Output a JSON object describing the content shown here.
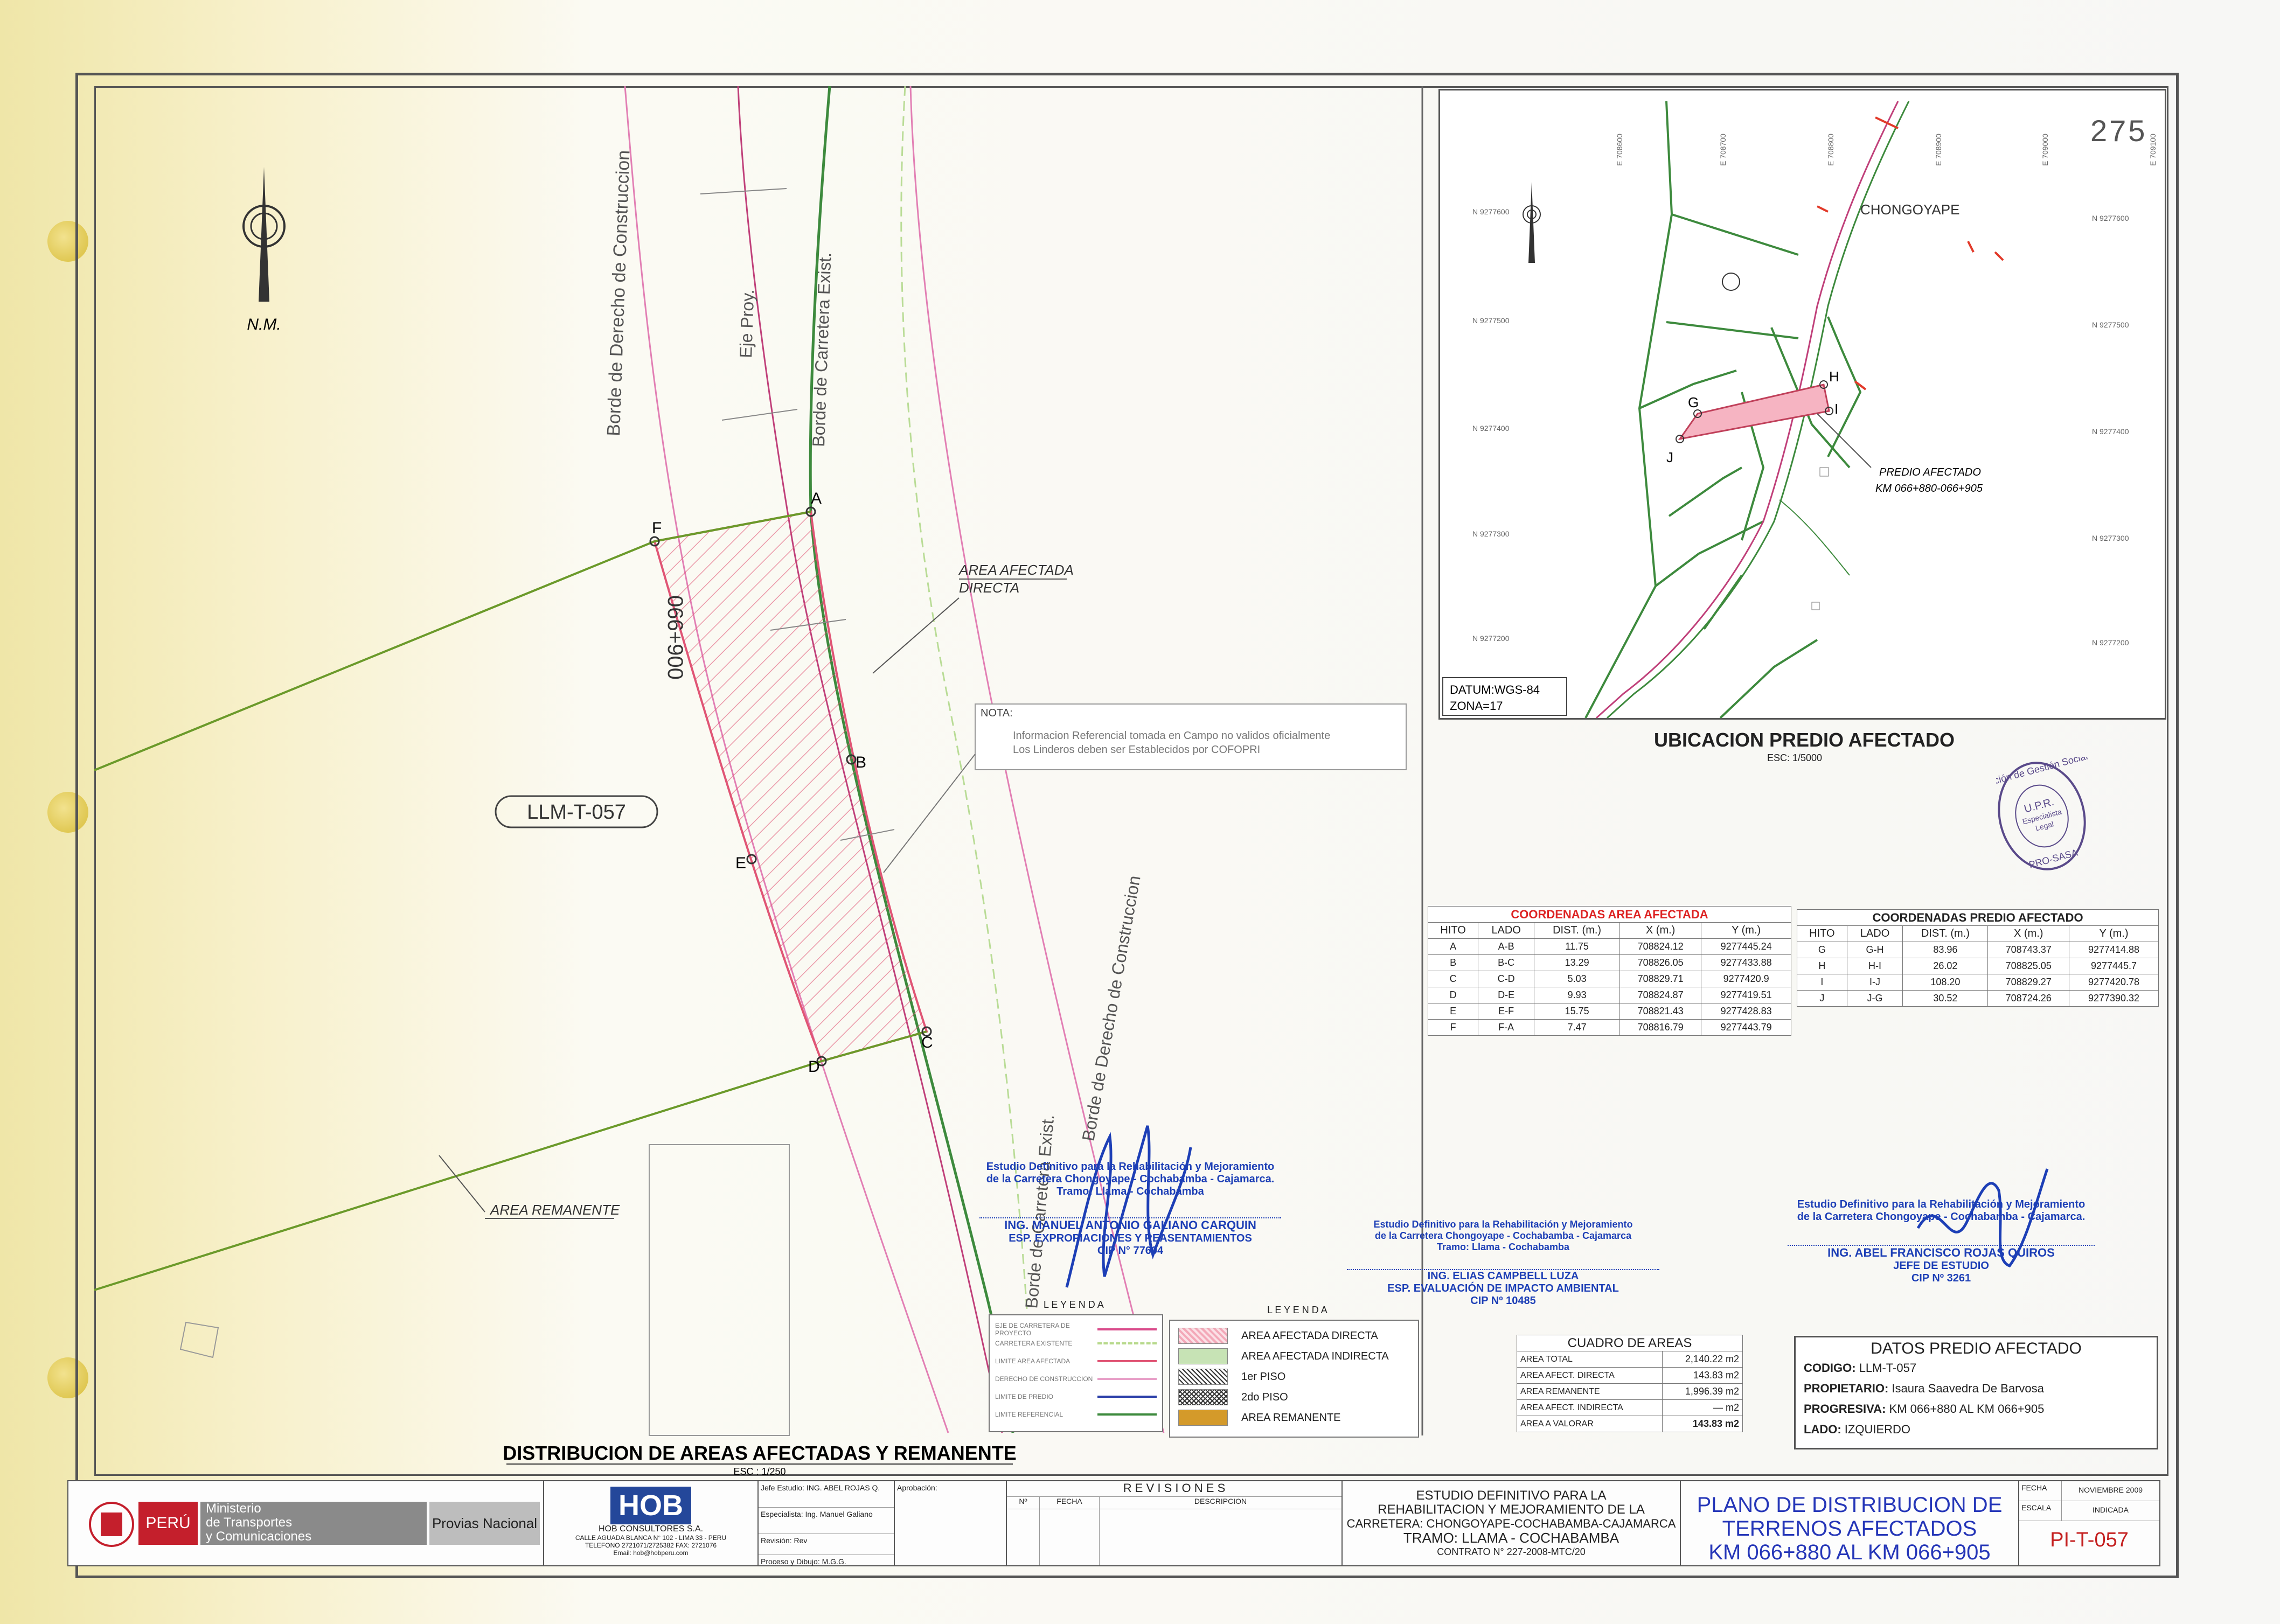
{
  "sheet_number": "275",
  "main_plan": {
    "labels": {
      "borde_derecho_left": "Borde de Derecho de Construccion",
      "eje_proy": "Eje Proy.",
      "borde_carretera_top": "Borde de Carretera Exist.",
      "borde_carretera_bottom": "Borde de Carretera Exist.",
      "borde_derecho_right": "Borde de Derecho de Construccion",
      "progresiva": "066+900",
      "lot_code": "LLM-T-057",
      "area_afectada_1": "AREA AFECTADA",
      "area_afectada_2": "DIRECTA",
      "area_remanente": "AREA REMANENTE",
      "north": "N.M."
    },
    "points": [
      "A",
      "B",
      "C",
      "D",
      "E",
      "F"
    ],
    "note_title": "NOTA:",
    "note_line1": "Informacion Referencial tomada en Campo no validos oficialmente",
    "note_line2": "Los Linderos deben ser Establecidos por COFOPRI",
    "title": "DISTRIBUCION DE AREAS AFECTADAS Y REMANENTE",
    "scale": "ESC : 1/250"
  },
  "location_map": {
    "town": "CHONGOYAPE",
    "points": [
      "G",
      "H",
      "I",
      "J"
    ],
    "predio_1": "PREDIO AFECTADO",
    "predio_2": "KM 066+880-066+905",
    "datum": "DATUM:WGS-84",
    "zona": "ZONA=17",
    "title": "UBICACION PREDIO AFECTADO",
    "scale": "ESC: 1/5000",
    "north_ticks": [
      "N 9277600",
      "N 9277500",
      "N 9277400",
      "N 9277300",
      "N 9277200"
    ],
    "east_ticks": [
      "E 708600",
      "E 708700",
      "E 708800",
      "E 708900",
      "E 709000",
      "E 709100"
    ]
  },
  "stamp": {
    "outer": "Dirección de Gestión Social",
    "inner_1": "U.P.R.",
    "inner_2": "Especialista",
    "inner_3": "Legal",
    "bottom": "PRO-SASA"
  },
  "coords_afectada": {
    "title": "COORDENADAS AREA AFECTADA",
    "headers": [
      "HITO",
      "LADO",
      "DIST. (m.)",
      "X (m.)",
      "Y (m.)"
    ],
    "rows": [
      [
        "A",
        "A-B",
        "11.75",
        "708824.12",
        "9277445.24"
      ],
      [
        "B",
        "B-C",
        "13.29",
        "708826.05",
        "9277433.88"
      ],
      [
        "C",
        "C-D",
        "5.03",
        "708829.71",
        "9277420.9"
      ],
      [
        "D",
        "D-E",
        "9.93",
        "708824.87",
        "9277419.51"
      ],
      [
        "E",
        "E-F",
        "15.75",
        "708821.43",
        "9277428.83"
      ],
      [
        "F",
        "F-A",
        "7.47",
        "708816.79",
        "9277443.79"
      ]
    ]
  },
  "coords_predio": {
    "title": "COORDENADAS PREDIO AFECTADO",
    "headers": [
      "HITO",
      "LADO",
      "DIST. (m.)",
      "X (m.)",
      "Y (m.)"
    ],
    "rows": [
      [
        "G",
        "G-H",
        "83.96",
        "708743.37",
        "9277414.88"
      ],
      [
        "H",
        "H-I",
        "26.02",
        "708825.05",
        "9277445.7"
      ],
      [
        "I",
        "I-J",
        "108.20",
        "708829.27",
        "9277420.78"
      ],
      [
        "J",
        "J-G",
        "30.52",
        "708724.26",
        "9277390.32"
      ]
    ]
  },
  "signatures": {
    "left": {
      "l1": "Estudio Definitivo para la Rehabilitación y Mejoramiento",
      "l2": "de la Carretera Chongoyape - Cochabamba - Cajamarca.",
      "l3": "Tramo: Llama - Cochabamba",
      "name": "ING. MANUEL ANTONIO GALIANO CARQUIN",
      "role": "ESP. EXPROPIACIONES Y REASENTAMIENTOS",
      "cip": "CIP N° 77604"
    },
    "middle": {
      "l1": "Estudio Definitivo para la Rehabilitación y Mejoramiento",
      "l2": "de la Carretera Chongoyape - Cochabamba - Cajamarca",
      "l3": "Tramo: Llama - Cochabamba",
      "name": "ING. ELIAS CAMPBELL LUZA",
      "role": "ESP. EVALUACIÓN DE IMPACTO AMBIENTAL",
      "cip": "CIP Nº 10485"
    },
    "right": {
      "l1": "Estudio Definitivo para la Rehabilitación y Mejoramiento",
      "l2": "de la Carretera Chongoyape - Cochabamba - Cajamarca.",
      "name": "ING. ABEL FRANCISCO ROJAS QUIROS",
      "role": "JEFE DE ESTUDIO",
      "cip": "CIP Nº 3261"
    }
  },
  "leyenda_lines": {
    "title": "L E Y E N D A",
    "items": [
      "EJE DE CARRETERA DE PROYECTO",
      "CARRETERA EXISTENTE",
      "LIMITE AREA AFECTADA",
      "DERECHO DE CONSTRUCCION",
      "LIMITE DE PREDIO",
      "LIMITE REFERENCIAL"
    ],
    "colors": [
      "#d94a8a",
      "#b7d98b",
      "#e05575",
      "#e8a0c8",
      "#2b3fa8",
      "#3d8a3d"
    ]
  },
  "leyenda_areas": {
    "title": "L E Y E N D A",
    "items": [
      "AREA AFECTADA DIRECTA",
      "AREA AFECTADA INDIRECTA",
      "1er PISO",
      "2do PISO",
      "AREA REMANENTE"
    ]
  },
  "cuadro_areas": {
    "title": "CUADRO DE AREAS",
    "rows": [
      [
        "AREA TOTAL",
        "2,140.22 m2"
      ],
      [
        "AREA AFECT. DIRECTA",
        "143.83 m2"
      ],
      [
        "AREA REMANENTE",
        "1,996.39 m2"
      ],
      [
        "AREA AFECT. INDIRECTA",
        "— m2"
      ],
      [
        "AREA A VALORAR",
        "143.83 m2"
      ]
    ]
  },
  "datos_predio": {
    "title": "DATOS PREDIO AFECTADO",
    "codigo_label": "CODIGO:",
    "codigo": "LLM-T-057",
    "propietario_label": "PROPIETARIO:",
    "propietario": "Isaura Saavedra De Barvosa",
    "progresiva_label": "PROGRESIVA:",
    "progresiva": "KM 066+880 AL KM 066+905",
    "lado_label": "LADO:",
    "lado": "IZQUIERDO"
  },
  "title_block": {
    "peru": "PERÚ",
    "ministerio_1": "Ministerio",
    "ministerio_2": "de Transportes",
    "ministerio_3": "y Comunicaciones",
    "provias": "Provias Nacional",
    "hob": "HOB",
    "hob_name": "HOB CONSULTORES S.A.",
    "hob_addr1": "CALLE AGUADA BLANCA N° 102 - LIMA 33 - PERU",
    "hob_addr2": "TELEFONO 2721071/2725382 FAX: 2721076",
    "hob_email": "Email: hob@hobperu.com",
    "jefe_label": "Jefe Estudio:",
    "jefe": "ING. ABEL ROJAS Q.",
    "esp_label": "Especialista:",
    "esp": "Ing. Manuel Galiano",
    "rev_label": "Revisión:",
    "rev": "Rev",
    "proc_label": "Proceso y Dibujo:",
    "proc": "M.G.G.",
    "aprob_label": "Aprobación:",
    "revisiones": "R E V I S I O N E S",
    "rev_headers": [
      "Nº",
      "FECHA",
      "DESCRIPCION"
    ],
    "estudio_1": "ESTUDIO DEFINITIVO PARA LA",
    "estudio_2": "REHABILITACION Y MEJORAMIENTO DE LA",
    "estudio_3": "CARRETERA: CHONGOYAPE-COCHABAMBA-CAJAMARCA",
    "estudio_4": "TRAMO: LLAMA - COCHABAMBA",
    "contrato": "CONTRATO N° 227-2008-MTC/20",
    "plano_1": "PLANO DE DISTRIBUCION DE",
    "plano_2": "TERRENOS AFECTADOS",
    "plano_3": "KM 066+880 AL KM 066+905",
    "fecha_label": "FECHA",
    "fecha": "NOVIEMBRE 2009",
    "escala_label": "ESCALA",
    "escala": "INDICADA",
    "plano_num": "PI-T-057"
  }
}
